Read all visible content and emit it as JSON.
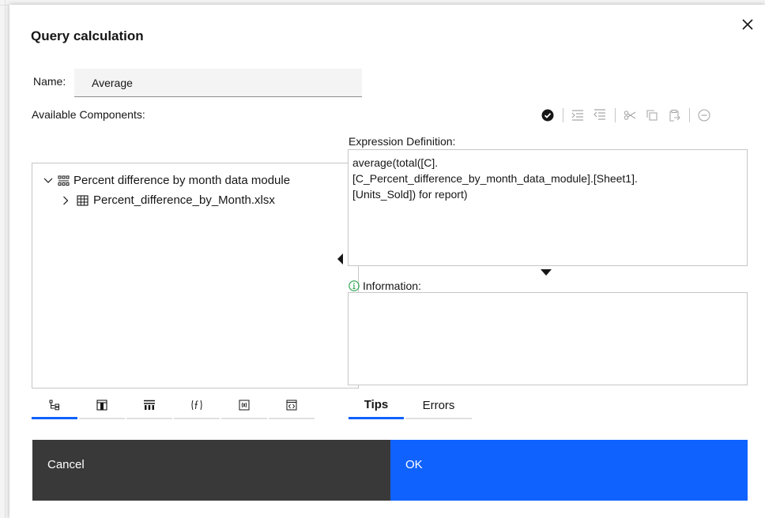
{
  "dialog": {
    "title": "Query calculation",
    "close_icon": "close-icon"
  },
  "name": {
    "label": "Name:",
    "value": "Average"
  },
  "available_components": {
    "label": "Available Components:",
    "tree": [
      {
        "label": "Percent difference by month data module",
        "icon": "data-module-icon",
        "expanded": true
      },
      {
        "label": "Percent_difference_by_Month.xlsx",
        "icon": "table-icon",
        "expanded": false
      }
    ],
    "tabs": [
      {
        "icon": "data-items-icon",
        "active": true
      },
      {
        "icon": "table-panel-icon",
        "active": false
      },
      {
        "icon": "columns-icon",
        "active": false
      },
      {
        "icon": "function-icon",
        "active": false
      },
      {
        "icon": "parameters-icon",
        "active": false
      },
      {
        "icon": "macros-icon",
        "active": false
      }
    ]
  },
  "toolbar": {
    "icons": [
      "validate-icon",
      "indent-icon",
      "outdent-icon",
      "cut-icon",
      "copy-icon",
      "paste-icon",
      "remove-icon"
    ]
  },
  "expression": {
    "label": "Expression Definition:",
    "value": "average(total([C].\n[C_Percent_difference_by_month_data_module].[Sheet1].\n[Units_Sold]) for report)"
  },
  "information": {
    "label": "Information:",
    "icon": "info-icon"
  },
  "bottom_tabs": [
    {
      "label": "Tips",
      "active": true
    },
    {
      "label": "Errors",
      "active": false
    }
  ],
  "buttons": {
    "cancel": "Cancel",
    "ok": "OK"
  },
  "colors": {
    "primary": "#0f62fe",
    "secondary": "#393939",
    "info": "#24a148"
  }
}
